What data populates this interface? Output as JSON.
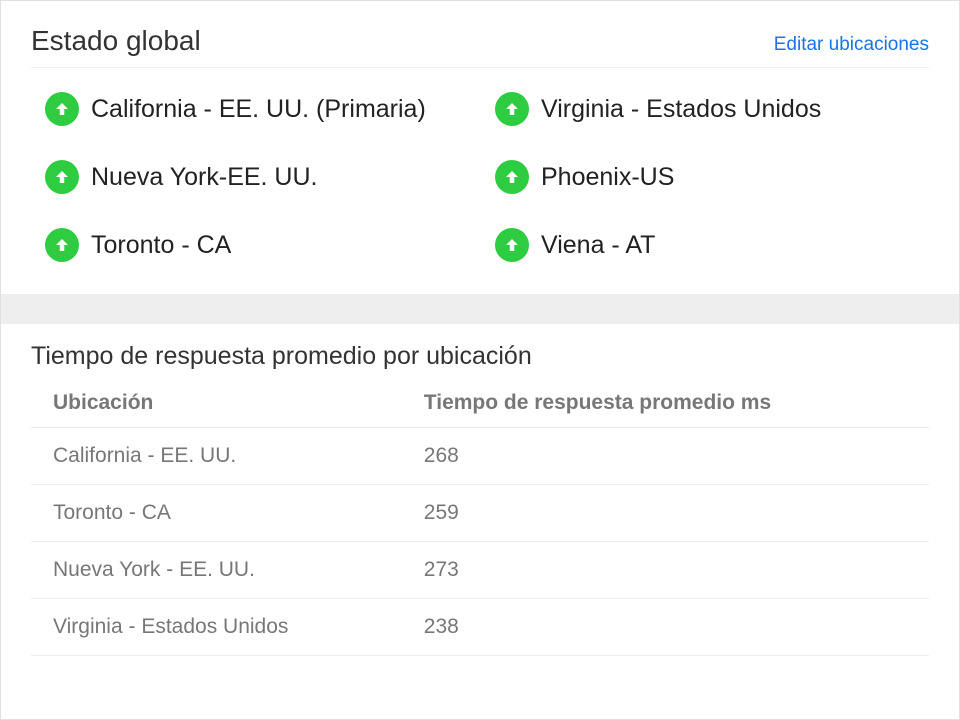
{
  "global": {
    "title": "Estado global",
    "edit_label": "Editar ubicaciones",
    "locations": [
      {
        "label": "California - EE. UU. (Primaria)",
        "status": "up"
      },
      {
        "label": "Virginia - Estados Unidos",
        "status": "up"
      },
      {
        "label": "Nueva York-EE. UU.",
        "status": "up"
      },
      {
        "label": "Phoenix-US",
        "status": "up"
      },
      {
        "label": "Toronto - CA",
        "status": "up"
      },
      {
        "label": "Viena - AT",
        "status": "up"
      }
    ]
  },
  "response_times": {
    "title": "Tiempo de respuesta promedio por ubicación",
    "headers": {
      "location": "Ubicación",
      "avg": "Tiempo de respuesta promedio ms"
    },
    "rows": [
      {
        "location": "California - EE. UU.",
        "avg": "268"
      },
      {
        "location": "Toronto - CA",
        "avg": "259"
      },
      {
        "location": "Nueva York - EE. UU.",
        "avg": "273"
      },
      {
        "location": "Virginia - Estados Unidos",
        "avg": "238"
      }
    ]
  },
  "colors": {
    "status_up": "#2ecc40",
    "link": "#1a73e8"
  }
}
